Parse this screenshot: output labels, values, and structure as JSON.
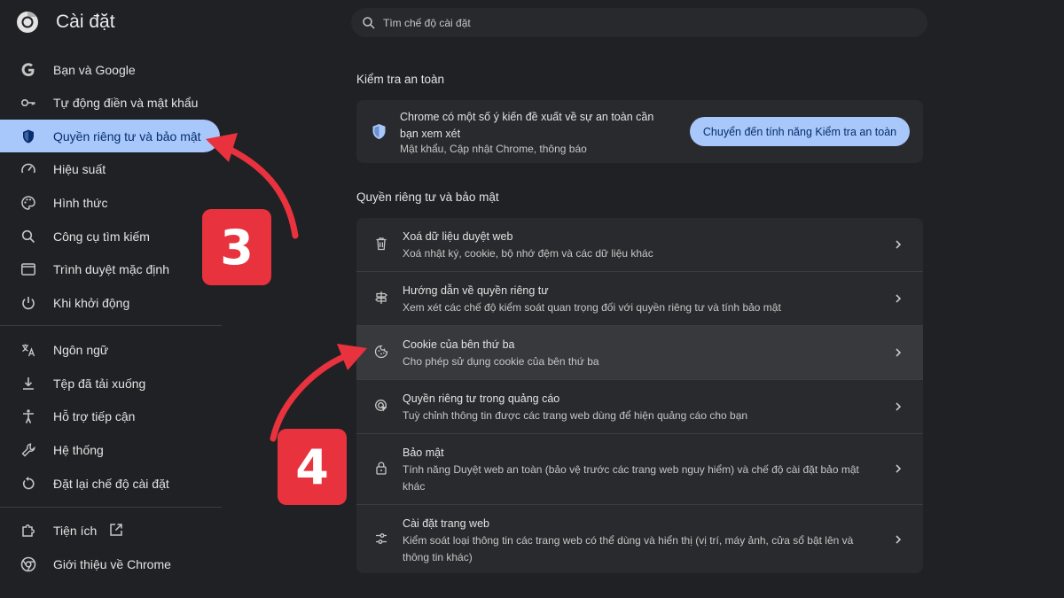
{
  "app": {
    "title": "Cài đặt"
  },
  "search": {
    "placeholder": "Tìm chế độ cài đặt"
  },
  "sidebar": {
    "items": [
      {
        "label": "Bạn và Google",
        "icon": "google-g-icon"
      },
      {
        "label": "Tự động điền và mật khẩu",
        "icon": "key-icon"
      },
      {
        "label": "Quyền riêng tư và bảo mật",
        "icon": "shield-icon",
        "active": true
      },
      {
        "label": "Hiệu suất",
        "icon": "speedometer-icon"
      },
      {
        "label": "Hình thức",
        "icon": "palette-icon"
      },
      {
        "label": "Công cụ tìm kiếm",
        "icon": "search-icon"
      },
      {
        "label": "Trình duyệt mặc định",
        "icon": "browser-window-icon"
      },
      {
        "label": "Khi khởi động",
        "icon": "power-icon"
      },
      {
        "label": "Ngôn ngữ",
        "icon": "translate-icon"
      },
      {
        "label": "Tệp đã tải xuống",
        "icon": "download-icon"
      },
      {
        "label": "Hỗ trợ tiếp cận",
        "icon": "accessibility-icon"
      },
      {
        "label": "Hệ thống",
        "icon": "wrench-icon"
      },
      {
        "label": "Đặt lại chế độ cài đặt",
        "icon": "reset-icon"
      },
      {
        "label": "Tiện ích",
        "icon": "puzzle-icon"
      },
      {
        "label": "Giới thiệu về Chrome",
        "icon": "chrome-icon"
      }
    ]
  },
  "safety": {
    "section_title": "Kiểm tra an toàn",
    "message": "Chrome có một số ý kiến đề xuất về sự an toàn cần bạn xem xét",
    "detail": "Mật khẩu, Cập nhật Chrome, thông báo",
    "button_label": "Chuyển đến tính năng Kiểm tra an toàn"
  },
  "privacy": {
    "section_title": "Quyền riêng tư và bảo mật",
    "rows": [
      {
        "title": "Xoá dữ liệu duyệt web",
        "subtitle": "Xoá nhật ký, cookie, bộ nhớ đệm và các dữ liệu khác",
        "icon": "trash-icon"
      },
      {
        "title": "Hướng dẫn về quyền riêng tư",
        "subtitle": "Xem xét các chế độ kiểm soát quan trọng đối với quyền riêng tư và tính bảo mật",
        "icon": "signpost-icon"
      },
      {
        "title": "Cookie của bên thứ ba",
        "subtitle": "Cho phép sử dụng cookie của bên thứ ba",
        "icon": "cookie-icon"
      },
      {
        "title": "Quyền riêng tư trong quảng cáo",
        "subtitle": "Tuỳ chỉnh thông tin được các trang web dùng để hiện quảng cáo cho bạn",
        "icon": "ad-target-icon"
      },
      {
        "title": "Bảo mật",
        "subtitle": "Tính năng Duyệt web an toàn (bảo vệ trước các trang web nguy hiểm) và chế độ cài đặt bảo mật khác",
        "icon": "lock-icon"
      },
      {
        "title": "Cài đặt trang web",
        "subtitle": "Kiểm soát loại thông tin các trang web có thể dùng và hiển thị (vị trí, máy ảnh, cửa sổ bật lên và thông tin khác)",
        "icon": "sliders-icon"
      }
    ]
  },
  "annotations": {
    "step3": "3",
    "step4": "4",
    "accent": "#e8323e"
  },
  "colors": {
    "background": "#202124",
    "card": "#292a2d",
    "accent": "#a8c7fa",
    "accent_text": "#062e6f"
  }
}
